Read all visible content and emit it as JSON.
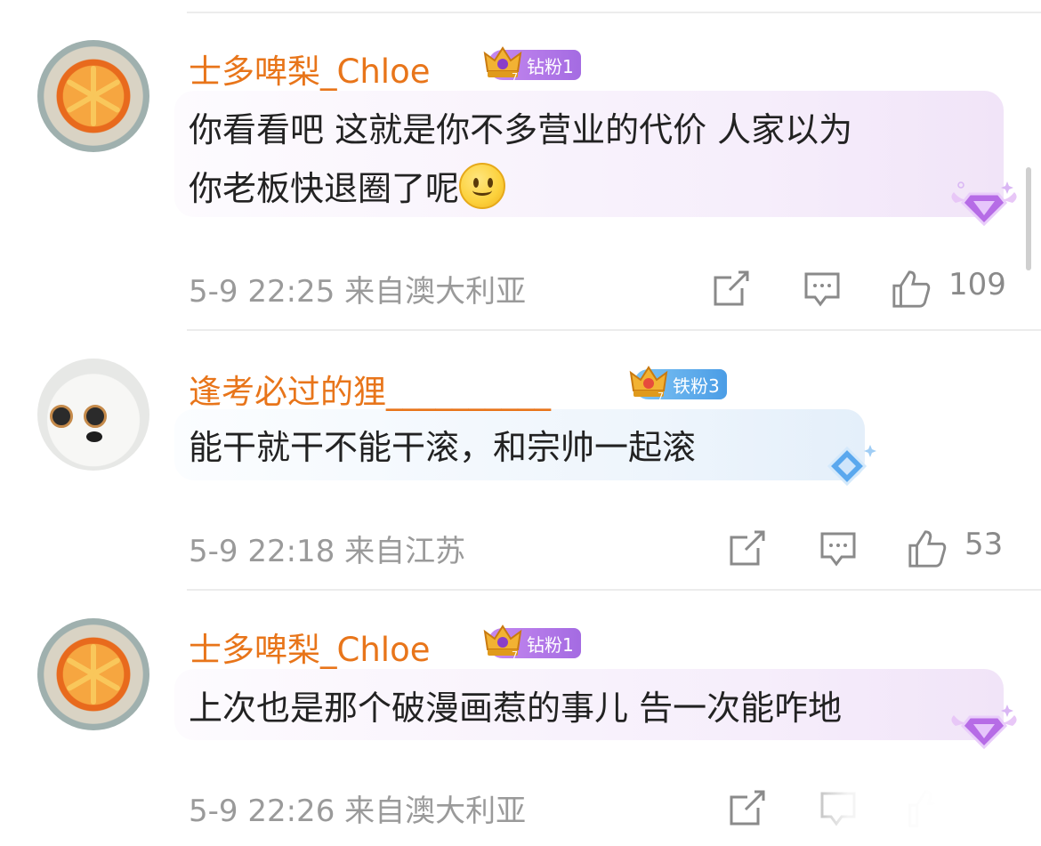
{
  "comments": [
    {
      "username": "士多啤梨_Chloe",
      "badge_label": "钻粉1",
      "badge_color": "#a46be2",
      "text_line1": "你看看吧 这就是你不多营业的代价 人家以为",
      "text_line2": "你老板快退圈了呢",
      "emoji": "smiley-emoji",
      "timestamp": "5-9 22:25",
      "location": "来自澳大利亚",
      "likes": "109"
    },
    {
      "username": "逢考必过的狸__________",
      "badge_label": "铁粉3",
      "badge_color": "#4b9de6",
      "text_line1": "能干就干不能干滚，和宗帅一起滚",
      "timestamp": "5-9 22:18",
      "location": "来自江苏",
      "likes": "53"
    },
    {
      "username": "士多啤梨_Chloe",
      "badge_label": "钻粉1",
      "badge_color": "#a46be2",
      "text_line1": "上次也是那个破漫画惹的事儿 告一次能咋地",
      "timestamp": "5-9 22:26",
      "location": "来自澳大利亚",
      "likes": ""
    }
  ],
  "icons": {
    "share": "share-icon",
    "reply": "comment-icon",
    "like": "thumbs-up-icon",
    "crown": "crown-icon",
    "gem": "diamond-gem-icon"
  },
  "colors": {
    "username": "#e8751a",
    "meta": "#9a9a9a",
    "purple_badge": "#a46be2",
    "blue_badge": "#4b9de6"
  }
}
